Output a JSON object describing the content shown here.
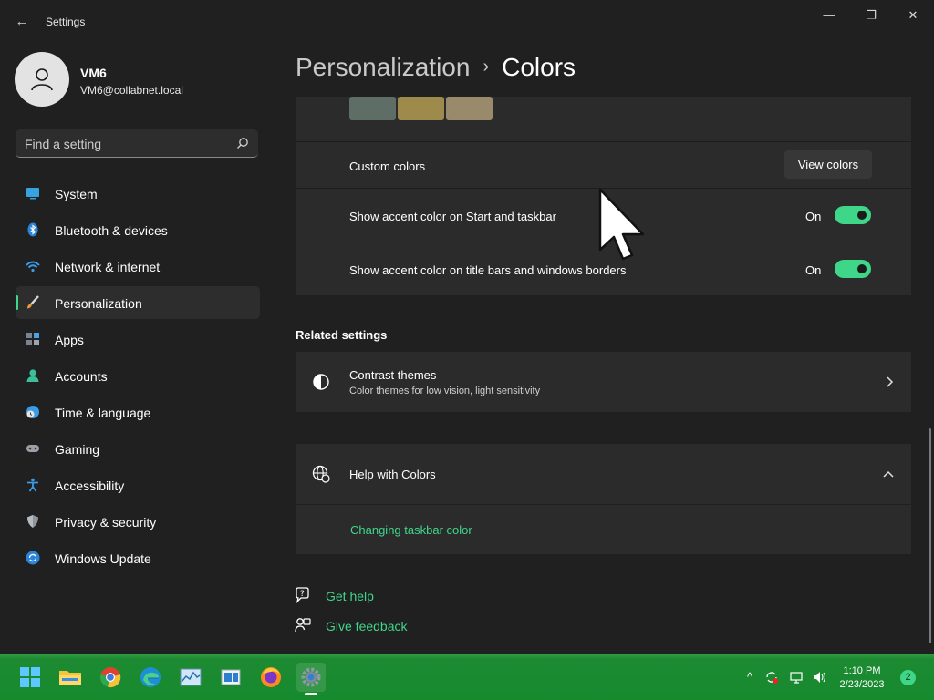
{
  "window": {
    "title": "Settings",
    "controls": {
      "minimize": "—",
      "maximize": "❐",
      "close": "✕"
    }
  },
  "profile": {
    "name": "VM6",
    "email": "VM6@collabnet.local"
  },
  "search": {
    "placeholder": "Find a setting"
  },
  "nav": {
    "selected": "Personalization",
    "items": [
      {
        "label": "System",
        "icon": "system-icon"
      },
      {
        "label": "Bluetooth & devices",
        "icon": "bluetooth-icon"
      },
      {
        "label": "Network & internet",
        "icon": "wifi-icon"
      },
      {
        "label": "Personalization",
        "icon": "brush-icon"
      },
      {
        "label": "Apps",
        "icon": "apps-icon"
      },
      {
        "label": "Accounts",
        "icon": "person-icon"
      },
      {
        "label": "Time & language",
        "icon": "globe-clock-icon"
      },
      {
        "label": "Gaming",
        "icon": "gamepad-icon"
      },
      {
        "label": "Accessibility",
        "icon": "accessibility-icon"
      },
      {
        "label": "Privacy & security",
        "icon": "shield-icon"
      },
      {
        "label": "Windows Update",
        "icon": "update-icon"
      }
    ]
  },
  "header": {
    "parent": "Personalization",
    "separator": "›",
    "current": "Colors"
  },
  "colors_card": {
    "swatches": [
      "#5e6e66",
      "#9e8a4a",
      "#9a8a6c"
    ],
    "custom_colors_label": "Custom colors",
    "view_colors_button": "View colors",
    "toggles": [
      {
        "label": "Show accent color on Start and taskbar",
        "state": "On"
      },
      {
        "label": "Show accent color on title bars and windows borders",
        "state": "On"
      }
    ]
  },
  "related": {
    "title": "Related settings",
    "contrast": {
      "title": "Contrast themes",
      "subtitle": "Color themes for low vision, light sensitivity"
    }
  },
  "help": {
    "title": "Help with Colors",
    "link": "Changing taskbar color"
  },
  "footer_links": {
    "get_help": "Get help",
    "give_feedback": "Give feedback"
  },
  "taskbar": {
    "apps": [
      "start-icon",
      "file-explorer-icon",
      "chrome-icon",
      "edge-icon",
      "perfmon-icon",
      "remote-desktop-icon",
      "firefox-icon",
      "settings-icon"
    ],
    "time": "1:10 PM",
    "date": "2/23/2023",
    "notification_count": "2"
  },
  "theme": {
    "accent": "#3fd68a",
    "background": "#202020",
    "card": "#2b2b2b",
    "taskbar": "#178a2e"
  }
}
